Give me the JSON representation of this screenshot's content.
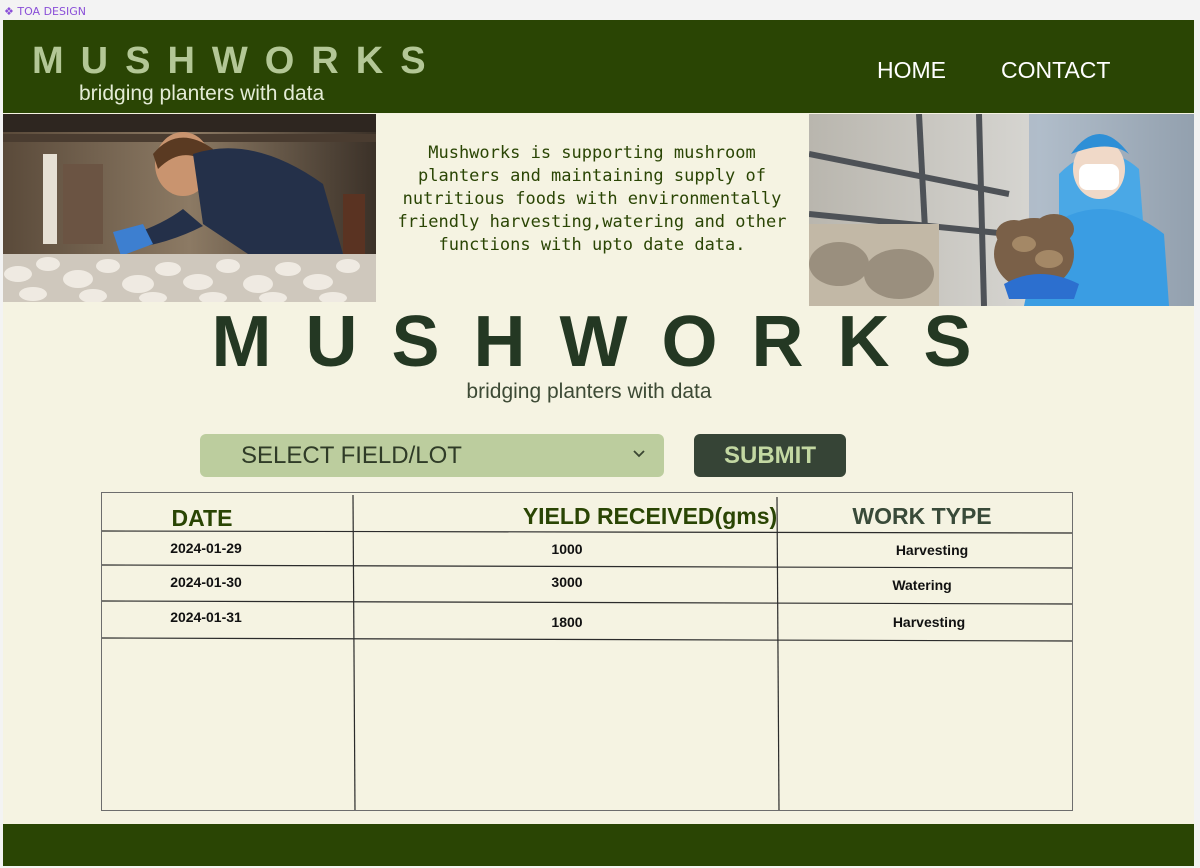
{
  "canvas": {
    "label": "TOA DESIGN"
  },
  "header": {
    "brand_title": "MUSHWORKS",
    "brand_subtitle": "bridging planters with data",
    "nav": {
      "home": "HOME",
      "contact": "CONTACT"
    }
  },
  "hero": {
    "description": "Mushworks is supporting mushroom planters and maintaining supply of nutritious foods with environmentally friendly harvesting,watering and other functions with upto date data."
  },
  "main": {
    "title": "MUSHWORKS",
    "subtitle": "bridging planters with data"
  },
  "controls": {
    "select_label": "SELECT FIELD/LOT",
    "submit_label": "SUBMIT"
  },
  "table": {
    "headers": {
      "date": "DATE",
      "yield": "YIELD RECEIVED(gms)",
      "work_type": "WORK TYPE"
    },
    "rows": [
      {
        "date": "2024-01-29",
        "yield": "1000",
        "work_type": "Harvesting"
      },
      {
        "date": "2024-01-30",
        "yield": "3000",
        "work_type": "Watering"
      },
      {
        "date": "2024-01-31",
        "yield": "1800",
        "work_type": "Harvesting"
      }
    ]
  },
  "colors": {
    "brand_green": "#2a4504",
    "background": "#f5f3e2",
    "select_bg": "#bccd9e",
    "button_bg": "#364436"
  }
}
